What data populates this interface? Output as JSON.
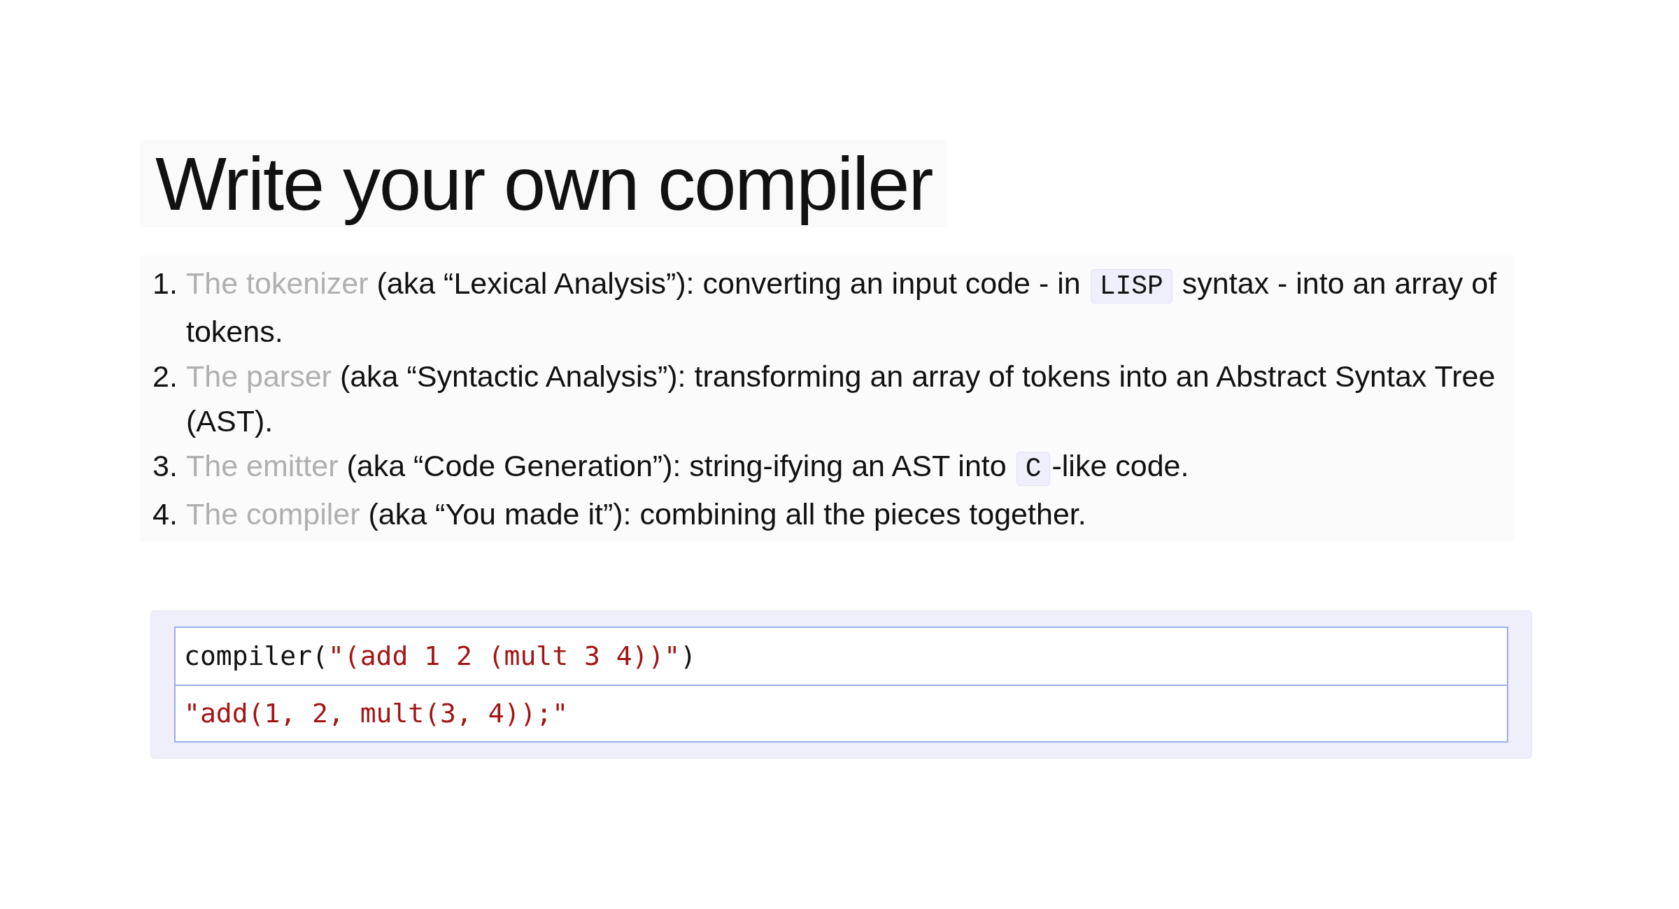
{
  "title": "Write your own compiler",
  "steps": [
    {
      "number": "1.",
      "segments": [
        {
          "kind": "link",
          "text": "The tokenizer"
        },
        {
          "kind": "text",
          "text": " (aka “Lexical Analysis”): converting an input code - in "
        },
        {
          "kind": "code",
          "text": "LISP"
        },
        {
          "kind": "text",
          "text": " syntax - into an array of tokens."
        }
      ]
    },
    {
      "number": "2.",
      "segments": [
        {
          "kind": "link",
          "text": "The parser"
        },
        {
          "kind": "text",
          "text": " (aka “Syntactic Analysis”): transforming an array of tokens into an Abstract Syntax Tree (AST)."
        }
      ]
    },
    {
      "number": "3.",
      "segments": [
        {
          "kind": "link",
          "text": "The emitter"
        },
        {
          "kind": "text",
          "text": " (aka “Code Generation”): string-ifying an AST into "
        },
        {
          "kind": "code",
          "text": "C"
        },
        {
          "kind": "text",
          "text": "-like code."
        }
      ]
    },
    {
      "number": "4.",
      "segments": [
        {
          "kind": "link",
          "text": "The compiler"
        },
        {
          "kind": "text",
          "text": " (aka “You made it”): combining all the pieces together."
        }
      ]
    }
  ],
  "code_cells": [
    {
      "tokens": [
        {
          "kind": "plain",
          "text": "compiler("
        },
        {
          "kind": "string",
          "text": "\"(add 1 2 (mult 3 4))\""
        },
        {
          "kind": "plain",
          "text": ")"
        }
      ]
    },
    {
      "tokens": [
        {
          "kind": "string",
          "text": "\"add(1, 2, mult(3, 4));\""
        }
      ]
    }
  ]
}
